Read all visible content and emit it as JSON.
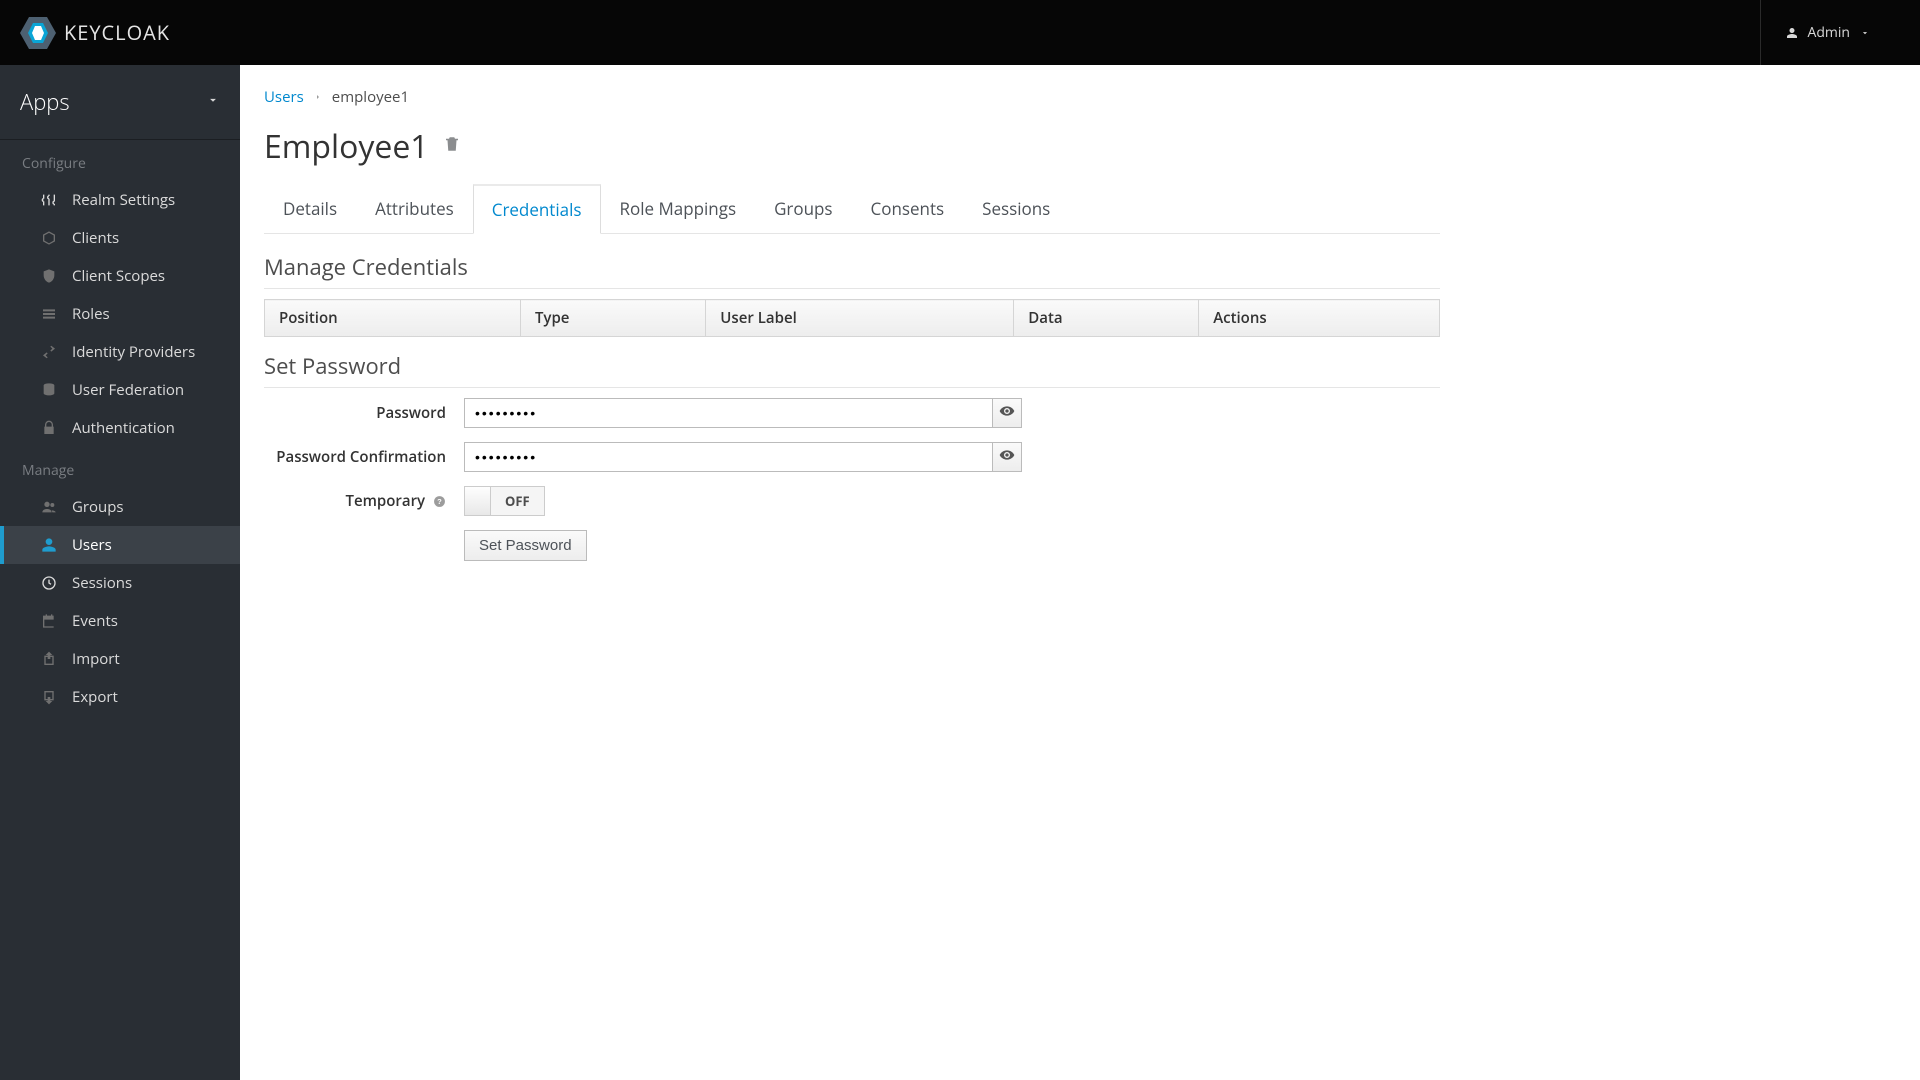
{
  "header": {
    "brand": "KEYCLOAK",
    "admin_label": "Admin"
  },
  "sidebar": {
    "realm_label": "Apps",
    "section_configure": "Configure",
    "section_manage": "Manage",
    "configure_items": [
      {
        "label": "Realm Settings",
        "icon": "sliders-icon"
      },
      {
        "label": "Clients",
        "icon": "cube-icon"
      },
      {
        "label": "Client Scopes",
        "icon": "shield-icon"
      },
      {
        "label": "Roles",
        "icon": "list-icon"
      },
      {
        "label": "Identity Providers",
        "icon": "exchange-icon"
      },
      {
        "label": "User Federation",
        "icon": "database-icon"
      },
      {
        "label": "Authentication",
        "icon": "lock-icon"
      }
    ],
    "manage_items": [
      {
        "label": "Groups",
        "icon": "group-icon"
      },
      {
        "label": "Users",
        "icon": "person-icon"
      },
      {
        "label": "Sessions",
        "icon": "clock-icon"
      },
      {
        "label": "Events",
        "icon": "calendar-icon"
      },
      {
        "label": "Import",
        "icon": "import-icon"
      },
      {
        "label": "Export",
        "icon": "export-icon"
      }
    ],
    "active_item": "Users"
  },
  "breadcrumb": {
    "root": "Users",
    "current": "employee1"
  },
  "page_title": "Employee1",
  "tabs": [
    "Details",
    "Attributes",
    "Credentials",
    "Role Mappings",
    "Groups",
    "Consents",
    "Sessions"
  ],
  "active_tab": "Credentials",
  "manage_credentials": {
    "title": "Manage Credentials",
    "columns": [
      "Position",
      "Type",
      "User Label",
      "Data",
      "Actions"
    ]
  },
  "set_password": {
    "title": "Set Password",
    "password_label": "Password",
    "password_value": "•••••••••",
    "confirm_label": "Password Confirmation",
    "confirm_value": "•••••••••",
    "temporary_label": "Temporary",
    "temporary_state": "OFF",
    "button_label": "Set Password"
  }
}
